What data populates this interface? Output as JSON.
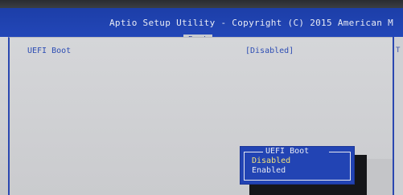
{
  "header": {
    "title": "Aptio Setup Utility - Copyright (C) 2015 American M",
    "active_tab": "Boot"
  },
  "main": {
    "setting": {
      "label": "UEFI Boot",
      "value": "[Disabled]"
    }
  },
  "help_panel": {
    "visible_text": "T"
  },
  "popup": {
    "title": "UEFI Boot",
    "options": [
      "Disabled",
      "Enabled"
    ],
    "selected": "Disabled"
  },
  "colors": {
    "title_bar": "#2347b8",
    "panel_bg": "#d5d6d9",
    "text_blue": "#2d4db3",
    "popup_bg": "#2244b4",
    "selected_option": "#f2e27a"
  }
}
